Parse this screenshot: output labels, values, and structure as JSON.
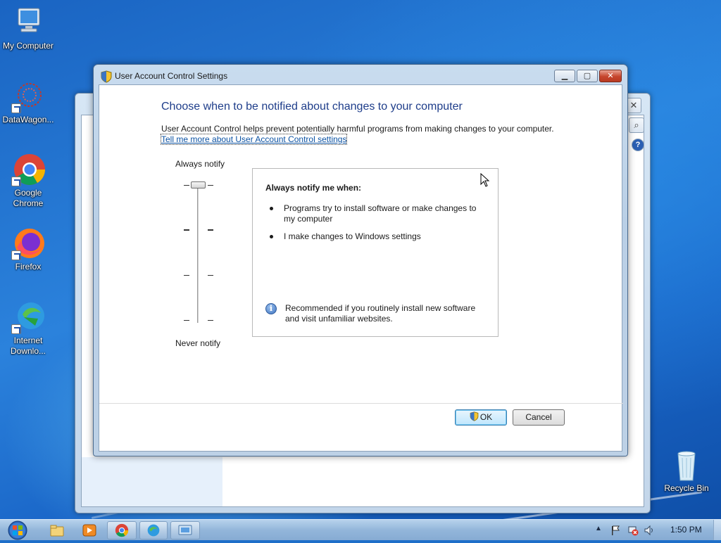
{
  "desktop": {
    "icons": [
      {
        "label": "My Computer"
      },
      {
        "label": "DataWagon..."
      },
      {
        "label": "Google Chrome"
      },
      {
        "label": "Firefox"
      },
      {
        "label": "Internet Downlo..."
      },
      {
        "label": "Recycle Bin"
      }
    ]
  },
  "dialog": {
    "title": "User Account Control Settings",
    "heading": "Choose when to be notified about changes to your computer",
    "description": "User Account Control helps prevent potentially harmful programs from making changes to your computer.",
    "link": "Tell me more about User Account Control settings",
    "slider": {
      "top_label": "Always notify",
      "bottom_label": "Never notify",
      "levels": 4,
      "selected_level": "Always notify"
    },
    "panel": {
      "heading": "Always notify me when:",
      "bullets": [
        "Programs try to install software or make changes to my computer",
        "I make changes to Windows settings"
      ],
      "note": "Recommended if you routinely install new software and visit unfamiliar websites."
    },
    "buttons": {
      "ok": "OK",
      "cancel": "Cancel"
    }
  },
  "taskbar": {
    "clock": "1:50 PM",
    "pinned": [
      "explorer-icon",
      "media-player-icon",
      "chrome-icon",
      "idm-icon",
      "control-panel-icon"
    ]
  },
  "colors": {
    "heading": "#1e3d8a",
    "link": "#0b52a3",
    "desktop_blue": "#1f6fc9"
  }
}
